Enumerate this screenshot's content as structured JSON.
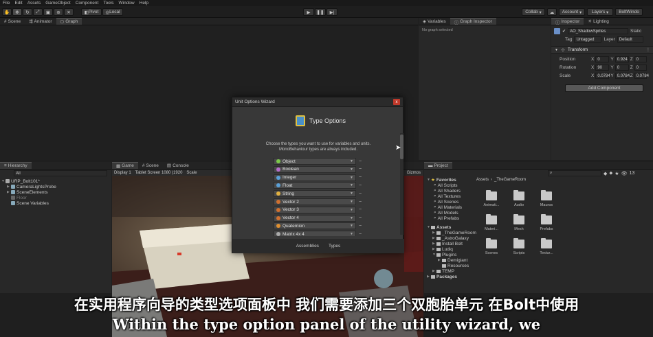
{
  "menubar": [
    "File",
    "Edit",
    "Assets",
    "GameObject",
    "Component",
    "Tools",
    "Window",
    "Help"
  ],
  "toolbar": {
    "pivot_label": "Pivot",
    "local_label": "Local",
    "collab_label": "Collab",
    "account_label": "Account",
    "layers_label": "Layers",
    "layout_label": "BoltWindo"
  },
  "top_tabs": {
    "scene": "Scene",
    "animator": "Animator",
    "graph": "Graph"
  },
  "variables_tabs": {
    "variables": "Variables",
    "graph_inspector": "Graph Inspector",
    "no_graph": "No graph selected"
  },
  "inspector": {
    "tab_inspector": "Inspector",
    "tab_lighting": "Lighting",
    "object_name": "AO_ShadowSprites",
    "static_label": "Static",
    "tag_label": "Tag",
    "tag_value": "Untagged",
    "layer_label": "Layer",
    "layer_value": "Default",
    "transform_title": "Transform",
    "position_label": "Position",
    "rotation_label": "Rotation",
    "scale_label": "Scale",
    "position": {
      "x": "0",
      "y": "0.924",
      "z": "0"
    },
    "rotation": {
      "x": "90",
      "y": "0",
      "z": "0"
    },
    "scale": {
      "x": "0.0784",
      "y": "0.0784",
      "z": "0.0784"
    },
    "add_component": "Add Component"
  },
  "hierarchy": {
    "tab": "Hierarchy",
    "search_placeholder": "All",
    "items": [
      "URP_Bolt101*",
      "CameraLightsProbe",
      "SceneElements",
      "Floor",
      "Scene Variables"
    ]
  },
  "game_tabs": {
    "game": "Game",
    "scene": "Scene",
    "console": "Console"
  },
  "game_bar": {
    "display": "Display 1",
    "resolution": "Tablet Screen 1080 (1920",
    "scale": "Scale",
    "gizmos": "Gizmos"
  },
  "dialog": {
    "title": "Unit Options Wizard",
    "heading": "Type Options",
    "desc_line1": "Choose the types you want to use for variables and units.",
    "desc_line2": "MonoBehaviour types are always included.",
    "types": [
      {
        "label": "Object",
        "color": "#7cc94a"
      },
      {
        "label": "Boolean",
        "color": "#b46cc9"
      },
      {
        "label": "Integer",
        "color": "#5aa0d8"
      },
      {
        "label": "Float",
        "color": "#5aa0d8"
      },
      {
        "label": "String",
        "color": "#e0b040"
      },
      {
        "label": "Vector 2",
        "color": "#d07030"
      },
      {
        "label": "Vector 3",
        "color": "#d07030"
      },
      {
        "label": "Vector 4",
        "color": "#d07030"
      },
      {
        "label": "Quaternion",
        "color": "#e09030"
      },
      {
        "label": "Matrix 4x 4",
        "color": "#aaaaaa"
      }
    ],
    "minus_symbol": "−",
    "footer_assemblies": "Assemblies",
    "footer_types": "Types",
    "close": "x"
  },
  "project": {
    "tab": "Project",
    "favorites_label": "Favorites",
    "favorites": [
      "All Scripts",
      "All Shaders",
      "All Textures",
      "All Scenes",
      "All Materials",
      "All Models",
      "All Prefabs"
    ],
    "assets_label": "Assets",
    "assets": [
      "_TheGameRoom",
      "_AstroGalaxy",
      "Install Bolt",
      "Ludiq",
      "Plugins",
      "Demigiant",
      "Resources",
      "TEMP"
    ],
    "packages_label": "Packages",
    "breadcrumb_root": "Assets",
    "breadcrumb_sep": "›",
    "breadcrumb_folder": "_TheGameRoom",
    "count_label": "13",
    "folders": [
      "Animati...",
      "Audio",
      "Mauros",
      "Materi...",
      "Mesh",
      "Prefabs",
      "Scenes",
      "Scripts",
      "Textur..."
    ]
  },
  "subtitles": {
    "cn": "在实用程序向导的类型选项面板中 我们需要添加三个双胞胎单元 在Bolt中使用",
    "en": "Within the type option panel of the utility wizard, we"
  },
  "colors": {
    "accent": "#3a72b0",
    "close_red": "#c0392b"
  }
}
